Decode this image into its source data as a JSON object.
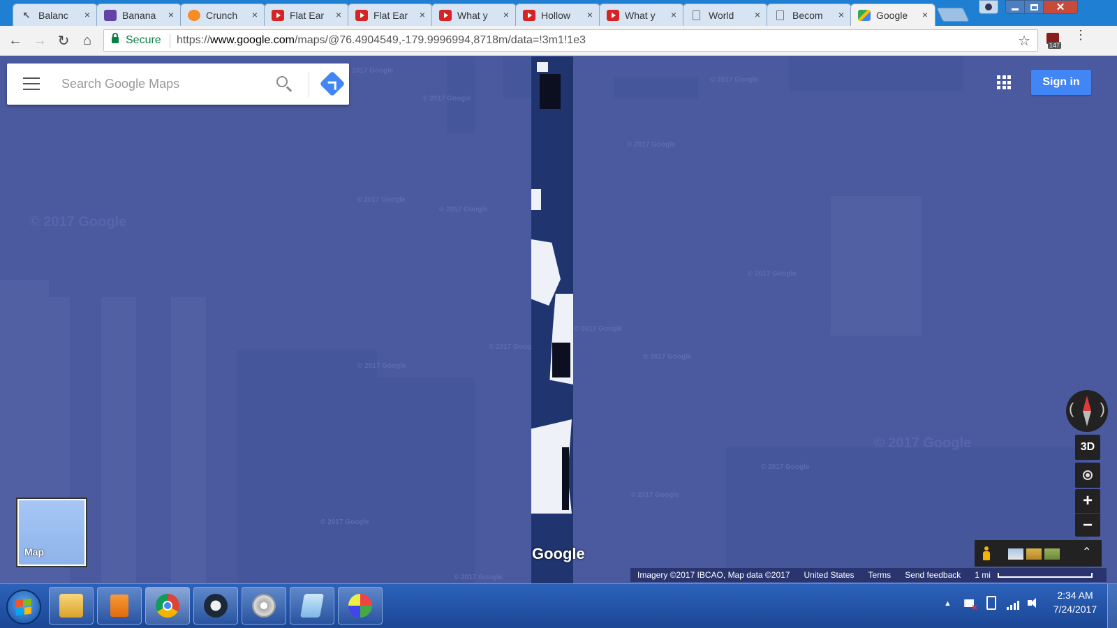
{
  "browser": {
    "tabs": [
      {
        "label": "Balanc",
        "icon": "balance-icon",
        "active": false
      },
      {
        "label": "Banana",
        "icon": "twitch-icon",
        "active": false
      },
      {
        "label": "Crunch",
        "icon": "crunchyroll-icon",
        "active": false
      },
      {
        "label": "Flat Ear",
        "icon": "youtube-icon",
        "active": false
      },
      {
        "label": "Flat Ear",
        "icon": "youtube-icon",
        "active": false
      },
      {
        "label": "What y",
        "icon": "youtube-icon",
        "active": false
      },
      {
        "label": "Hollow",
        "icon": "youtube-icon",
        "active": false
      },
      {
        "label": "What y",
        "icon": "youtube-icon",
        "active": false
      },
      {
        "label": "World",
        "icon": "document-icon",
        "active": false
      },
      {
        "label": "Becom",
        "icon": "document-icon",
        "active": false
      },
      {
        "label": "Google",
        "icon": "google-maps-icon",
        "active": true
      }
    ],
    "tab_close_glyph": "×",
    "window_close_glyph": "✕",
    "omnibox": {
      "secure_label": "Secure",
      "url_scheme": "https://",
      "url_domain": "www.google.com",
      "url_path": "/maps/@76.4904549,-179.9996994,8718m/data=!3m1!1e3"
    },
    "extension_badge": "147",
    "nav_glyphs": {
      "back": "←",
      "forward": "→",
      "reload": "↻",
      "home": "⌂",
      "star": "☆",
      "menu": "⋮"
    }
  },
  "maps": {
    "search_placeholder": "Search Google Maps",
    "sign_in_label": "Sign in",
    "layer_label": "Map",
    "btn_3d": "3D",
    "zoom_in": "+",
    "zoom_out": "−",
    "expand_glyph": "⌃",
    "logo": "Google",
    "watermark": "© 2017 Google",
    "footer": {
      "attribution": "Imagery ©2017 IBCAO, Map data ©2017",
      "region": "United States",
      "terms": "Terms",
      "feedback": "Send feedback",
      "scale": "1 mi"
    },
    "colors": {
      "accent": "#4285f4",
      "water": "#4b5a9f",
      "strip": "#20346f"
    }
  },
  "taskbar": {
    "apps": [
      "file-explorer",
      "media-player",
      "chrome",
      "steam",
      "sound-recorder",
      "notepad",
      "paint"
    ],
    "time": "2:34 AM",
    "date": "7/24/2017",
    "tray_arrow": "▲"
  }
}
